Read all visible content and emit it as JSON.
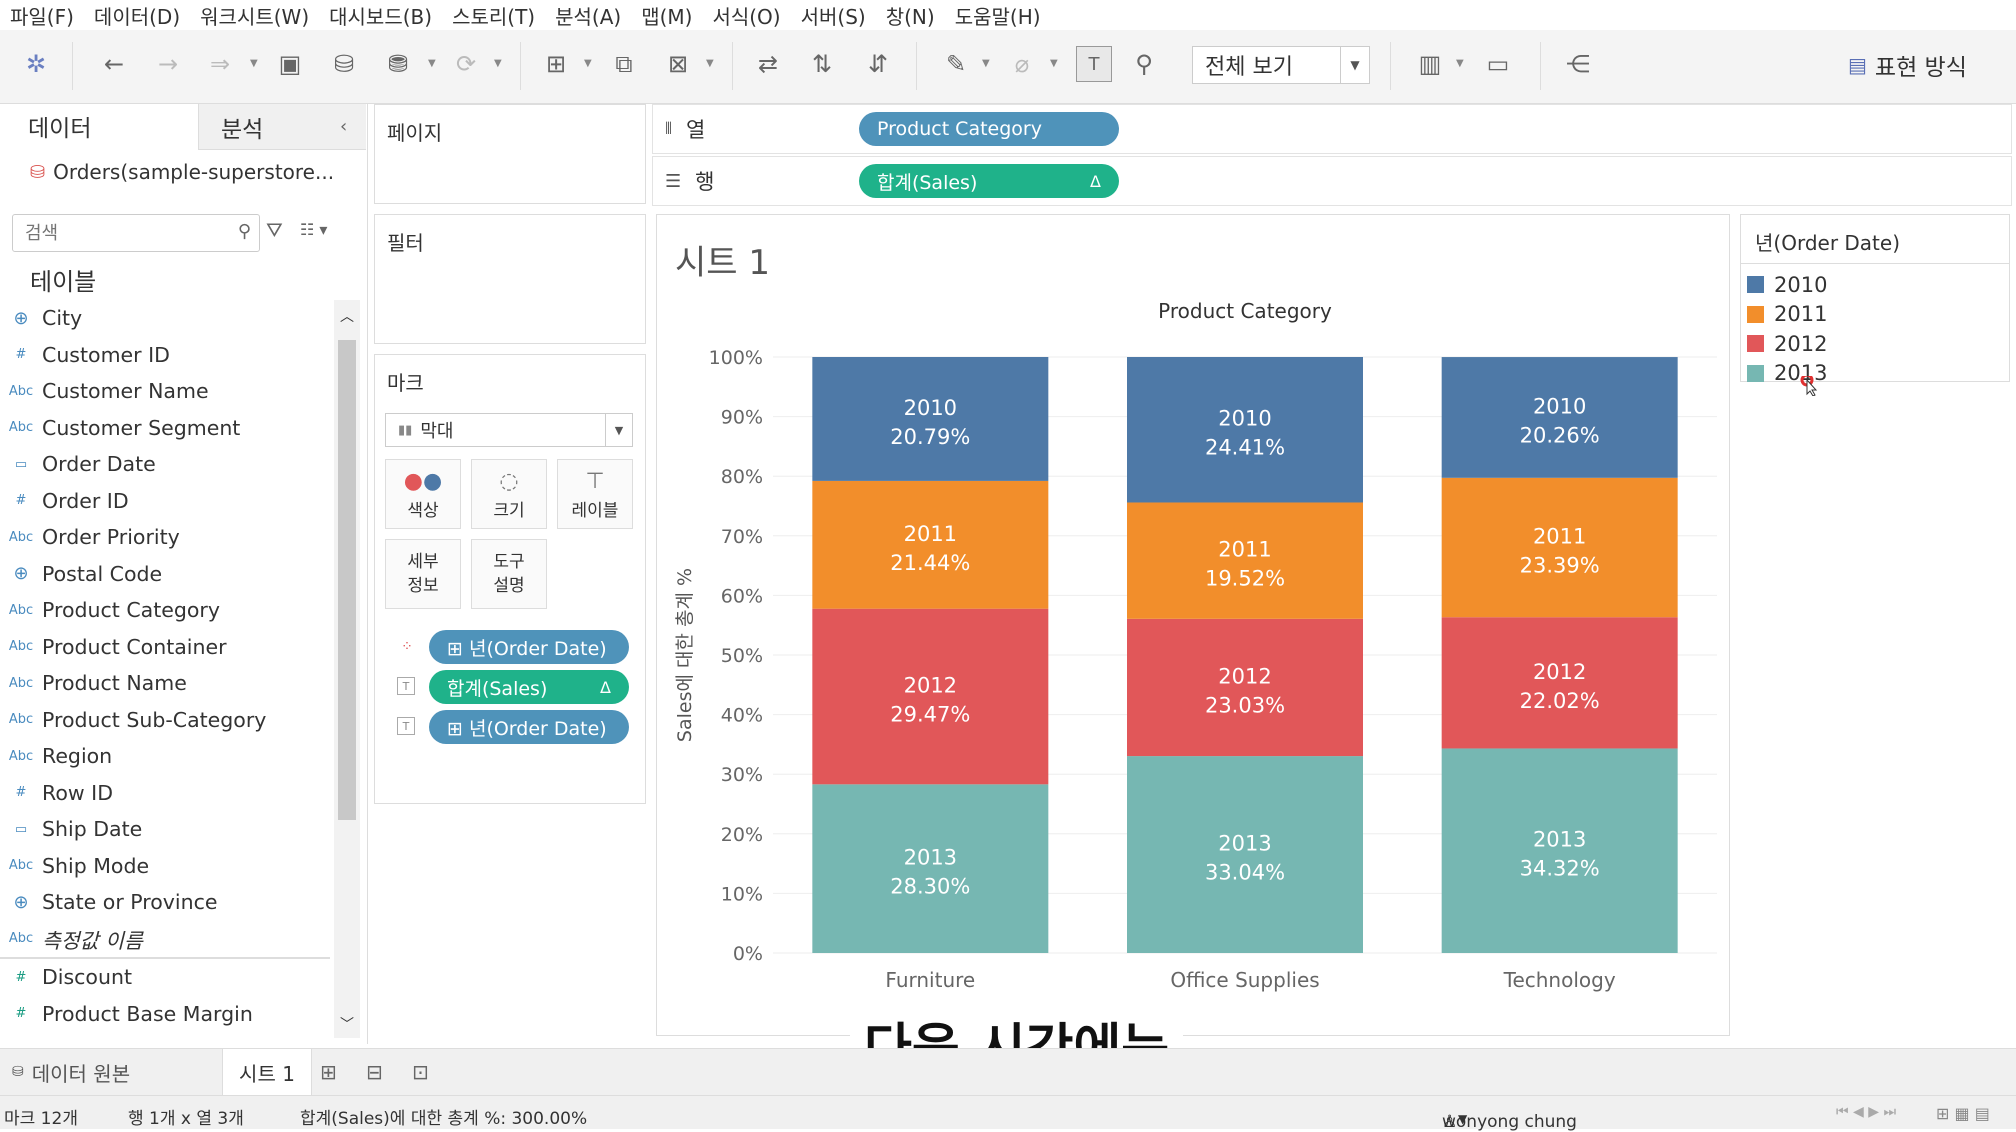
{
  "menu": [
    "파일(F)",
    "데이터(D)",
    "워크시트(W)",
    "대시보드(B)",
    "스토리(T)",
    "분석(A)",
    "맵(M)",
    "서식(O)",
    "서버(S)",
    "창(N)",
    "도움말(H)"
  ],
  "toolbar": {
    "fit_label": "전체 보기",
    "show_me_label": "표현 방식"
  },
  "data_pane": {
    "tab_data": "데이터",
    "tab_analysis": "분석",
    "datasource": "Orders(sample-superstore...",
    "search_placeholder": "검색",
    "tables_title": "테이블",
    "fields": [
      {
        "type": "geo",
        "type_glyph": "⊕",
        "label": "City"
      },
      {
        "type": "num",
        "type_glyph": "#",
        "label": "Customer ID"
      },
      {
        "type": "str",
        "type_glyph": "Abc",
        "label": "Customer Name"
      },
      {
        "type": "str",
        "type_glyph": "Abc",
        "label": "Customer Segment"
      },
      {
        "type": "date",
        "type_glyph": "▭",
        "label": "Order Date"
      },
      {
        "type": "num",
        "type_glyph": "#",
        "label": "Order ID"
      },
      {
        "type": "str",
        "type_glyph": "Abc",
        "label": "Order Priority"
      },
      {
        "type": "geo",
        "type_glyph": "⊕",
        "label": "Postal Code"
      },
      {
        "type": "str",
        "type_glyph": "Abc",
        "label": "Product Category"
      },
      {
        "type": "str",
        "type_glyph": "Abc",
        "label": "Product Container"
      },
      {
        "type": "str",
        "type_glyph": "Abc",
        "label": "Product Name"
      },
      {
        "type": "str",
        "type_glyph": "Abc",
        "label": "Product Sub-Category"
      },
      {
        "type": "str",
        "type_glyph": "Abc",
        "label": "Region"
      },
      {
        "type": "num",
        "type_glyph": "#",
        "label": "Row ID"
      },
      {
        "type": "date",
        "type_glyph": "▭",
        "label": "Ship Date"
      },
      {
        "type": "str",
        "type_glyph": "Abc",
        "label": "Ship Mode"
      },
      {
        "type": "geo",
        "type_glyph": "⊕",
        "label": "State or Province"
      },
      {
        "type": "str",
        "type_glyph": "Abc",
        "label": "측정값 이름",
        "italic": true
      },
      {
        "type": "measure",
        "type_glyph": "#",
        "label": "Discount"
      },
      {
        "type": "measure",
        "type_glyph": "#",
        "label": "Product Base Margin"
      }
    ]
  },
  "pages_card": {
    "title": "페이지"
  },
  "filters_card": {
    "title": "필터"
  },
  "marks_card": {
    "title": "마크",
    "mark_type": "막대",
    "buttons": {
      "color": "색상",
      "size": "크기",
      "label": "레이블",
      "detail_1": "세부",
      "detail_2": "정보",
      "tooltip_1": "도구",
      "tooltip_2": "설명"
    },
    "pills": [
      {
        "label": "⊞ 년(Order Date)",
        "color": "blue",
        "icon": "color-dots"
      },
      {
        "label": "합계(Sales)",
        "color": "green",
        "icon": "text",
        "delta": "Δ"
      },
      {
        "label": "⊞ 년(Order Date)",
        "color": "blue",
        "icon": "text"
      }
    ]
  },
  "shelves": {
    "columns_label": "열",
    "rows_label": "행",
    "columns_pill": "Product Category",
    "rows_pill": "합계(Sales)",
    "rows_delta": "Δ"
  },
  "viz": {
    "sheet_title": "시트 1"
  },
  "legend": {
    "title": "년(Order Date)",
    "items": [
      {
        "label": "2010",
        "color": "#4e79a7"
      },
      {
        "label": "2011",
        "color": "#f28e2b"
      },
      {
        "label": "2012",
        "color": "#e15759"
      },
      {
        "label": "2013",
        "color": "#76b7b2"
      }
    ]
  },
  "chart_data": {
    "type": "bar",
    "stacked": true,
    "title": "Product Category",
    "xlabel": "",
    "ylabel": "Sales에 대한 총계 %",
    "ylim": [
      0,
      100
    ],
    "yticks": [
      "100%",
      "90%",
      "80%",
      "70%",
      "60%",
      "50%",
      "40%",
      "30%",
      "20%",
      "10%",
      "0%"
    ],
    "categories": [
      "Furniture",
      "Office Supplies",
      "Technology"
    ],
    "series": [
      {
        "name": "2013",
        "color": "#76b7b2",
        "values": [
          28.3,
          33.04,
          34.32
        ],
        "labels": [
          "28.30%",
          "33.04%",
          "34.32%"
        ]
      },
      {
        "name": "2012",
        "color": "#e15759",
        "values": [
          29.47,
          23.03,
          22.02
        ],
        "labels": [
          "29.47%",
          "23.03%",
          "22.02%"
        ]
      },
      {
        "name": "2011",
        "color": "#f28e2b",
        "values": [
          21.44,
          19.52,
          23.39
        ],
        "labels": [
          "21.44%",
          "19.52%",
          "23.39%"
        ]
      },
      {
        "name": "2010",
        "color": "#4e79a7",
        "values": [
          20.79,
          24.41,
          20.26
        ],
        "labels": [
          "20.79%",
          "24.41%",
          "20.26%"
        ]
      }
    ],
    "grid": true,
    "legend": "right"
  },
  "sheet_tabs": {
    "datasource_tab": "데이터 원본",
    "sheet1": "시트 1"
  },
  "status": {
    "marks": "마크 12개",
    "rowscols": "행 1개 x 열 3개",
    "sum": "합계(Sales)에 대한 총계 %: 300.00%",
    "user": "wonyong chung"
  },
  "subtitle": "다음 시간에는"
}
